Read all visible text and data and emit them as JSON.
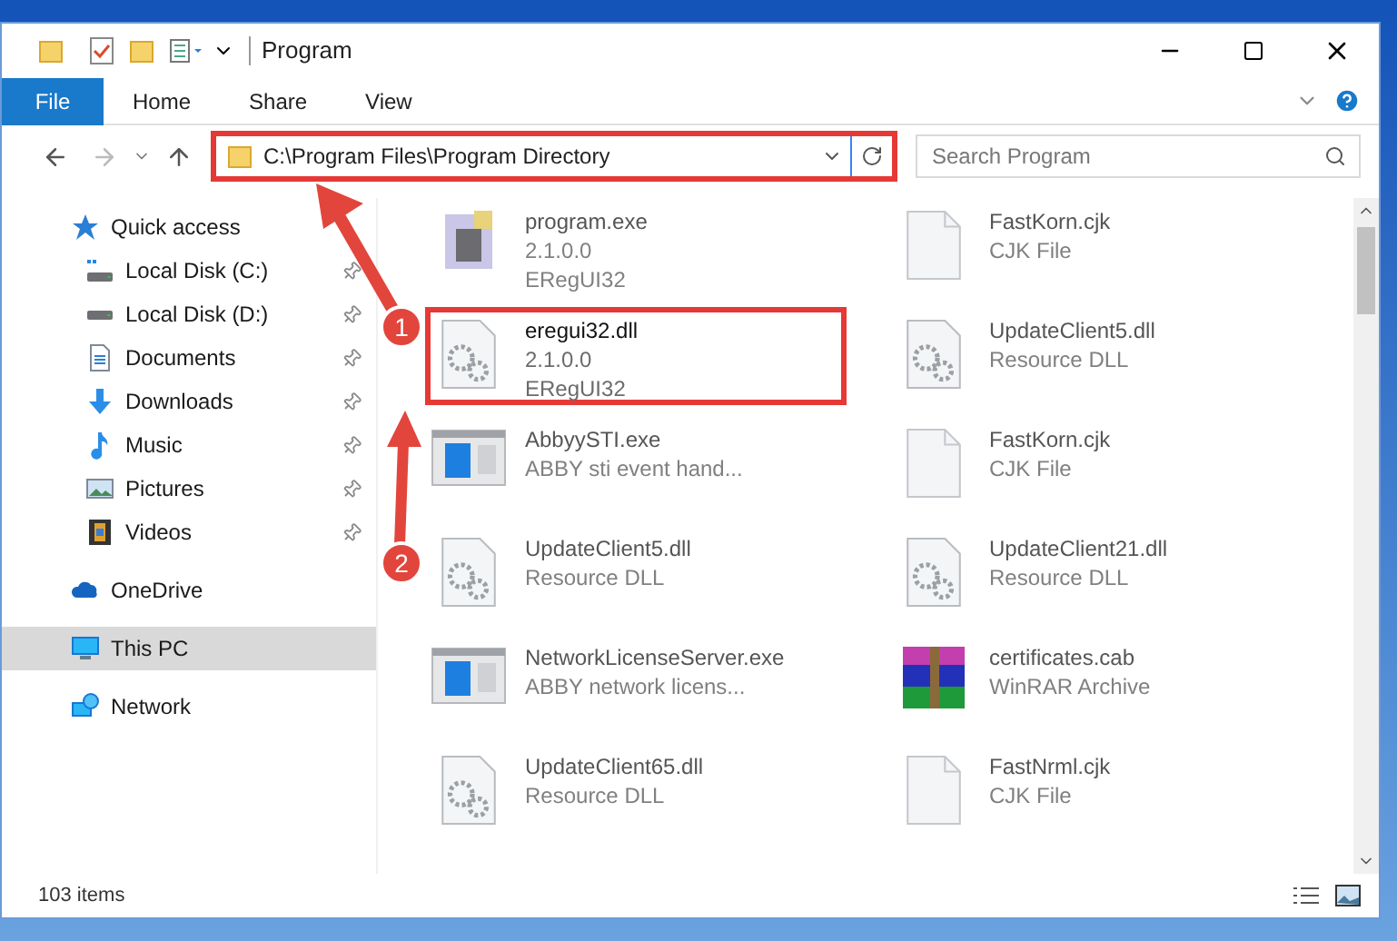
{
  "window": {
    "title": "Program"
  },
  "ribbon_tabs": [
    {
      "label": "File",
      "selected": true
    },
    {
      "label": "Home",
      "selected": false
    },
    {
      "label": "Share",
      "selected": false
    },
    {
      "label": "View",
      "selected": false
    }
  ],
  "address": {
    "value": "C:\\Program Files\\Program Directory",
    "highlighted": true
  },
  "search": {
    "placeholder": "Search Program"
  },
  "sidebar": {
    "items": [
      {
        "label": "Quick access",
        "kind": "star",
        "selected": false,
        "children": [
          {
            "label": "Local Disk (C:)",
            "kind": "disk-c",
            "pinned": true
          },
          {
            "label": "Local Disk (D:)",
            "kind": "disk",
            "pinned": true
          },
          {
            "label": "Documents",
            "kind": "doc",
            "pinned": true
          },
          {
            "label": "Downloads",
            "kind": "download",
            "pinned": true
          },
          {
            "label": "Music",
            "kind": "music",
            "pinned": true
          },
          {
            "label": "Pictures",
            "kind": "pictures",
            "pinned": true
          },
          {
            "label": "Videos",
            "kind": "videos",
            "pinned": true
          }
        ]
      },
      {
        "label": "OneDrive",
        "kind": "cloud",
        "selected": false
      },
      {
        "label": "This PC",
        "kind": "pc",
        "selected": true
      },
      {
        "label": "Network",
        "kind": "network",
        "selected": false
      }
    ]
  },
  "files": [
    {
      "name": "program.exe",
      "details": [
        "2.1.0.0",
        "ERegUI32"
      ],
      "kind": "exe",
      "blurred": true,
      "highlighted": false
    },
    {
      "name": "FastKorn.cjk",
      "details": [
        "CJK File"
      ],
      "kind": "blank",
      "blurred": true,
      "highlighted": false
    },
    {
      "name": "eregui32.dll",
      "details": [
        "2.1.0.0",
        "ERegUI32"
      ],
      "kind": "dll",
      "blurred": false,
      "highlighted": true
    },
    {
      "name": "UpdateClient5.dll",
      "details": [
        "Resource DLL"
      ],
      "kind": "dll",
      "blurred": true,
      "highlighted": false
    },
    {
      "name": "AbbyySTI.exe",
      "details": [
        "ABBY sti event hand..."
      ],
      "kind": "app",
      "blurred": true,
      "highlighted": false
    },
    {
      "name": "FastKorn.cjk",
      "details": [
        "CJK File"
      ],
      "kind": "blank",
      "blurred": true,
      "highlighted": false
    },
    {
      "name": "UpdateClient5.dll",
      "details": [
        "Resource DLL"
      ],
      "kind": "dll",
      "blurred": true,
      "highlighted": false
    },
    {
      "name": "UpdateClient21.dll",
      "details": [
        "Resource DLL"
      ],
      "kind": "dll",
      "blurred": true,
      "highlighted": false
    },
    {
      "name": "NetworkLicenseServer.exe",
      "details": [
        "ABBY network licens..."
      ],
      "kind": "app",
      "blurred": true,
      "highlighted": false
    },
    {
      "name": "certificates.cab",
      "details": [
        "WinRAR Archive"
      ],
      "kind": "cab",
      "blurred": true,
      "highlighted": false
    },
    {
      "name": "UpdateClient65.dll",
      "details": [
        "Resource DLL"
      ],
      "kind": "dll",
      "blurred": true,
      "highlighted": false
    },
    {
      "name": "FastNrml.cjk",
      "details": [
        "CJK File"
      ],
      "kind": "blank",
      "blurred": true,
      "highlighted": false
    }
  ],
  "status_bar": {
    "count": "103 items"
  },
  "annotations": [
    {
      "number": "1"
    },
    {
      "number": "2"
    }
  ]
}
